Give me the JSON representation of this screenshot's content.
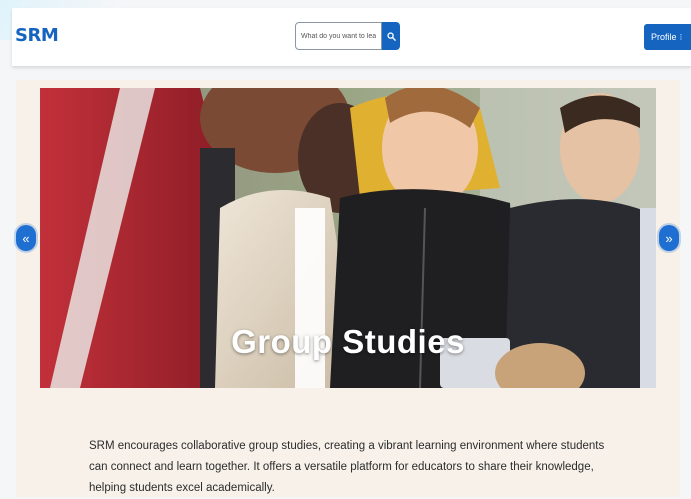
{
  "brand": {
    "logo": "SRM",
    "accent": "#1565c0"
  },
  "search": {
    "placeholder": "What do you want to learn?",
    "icon": "search-icon"
  },
  "profile": {
    "label": "Profile",
    "menu_glyph": "⁝"
  },
  "carousel": {
    "prev_glyph": "«",
    "next_glyph": "»",
    "slide_caption": "Group Studies"
  },
  "description": {
    "text": "SRM encourages collaborative group studies, creating a vibrant learning environment where students can connect and learn together. It offers a versatile platform for educators to share their knowledge, helping students excel academically."
  }
}
